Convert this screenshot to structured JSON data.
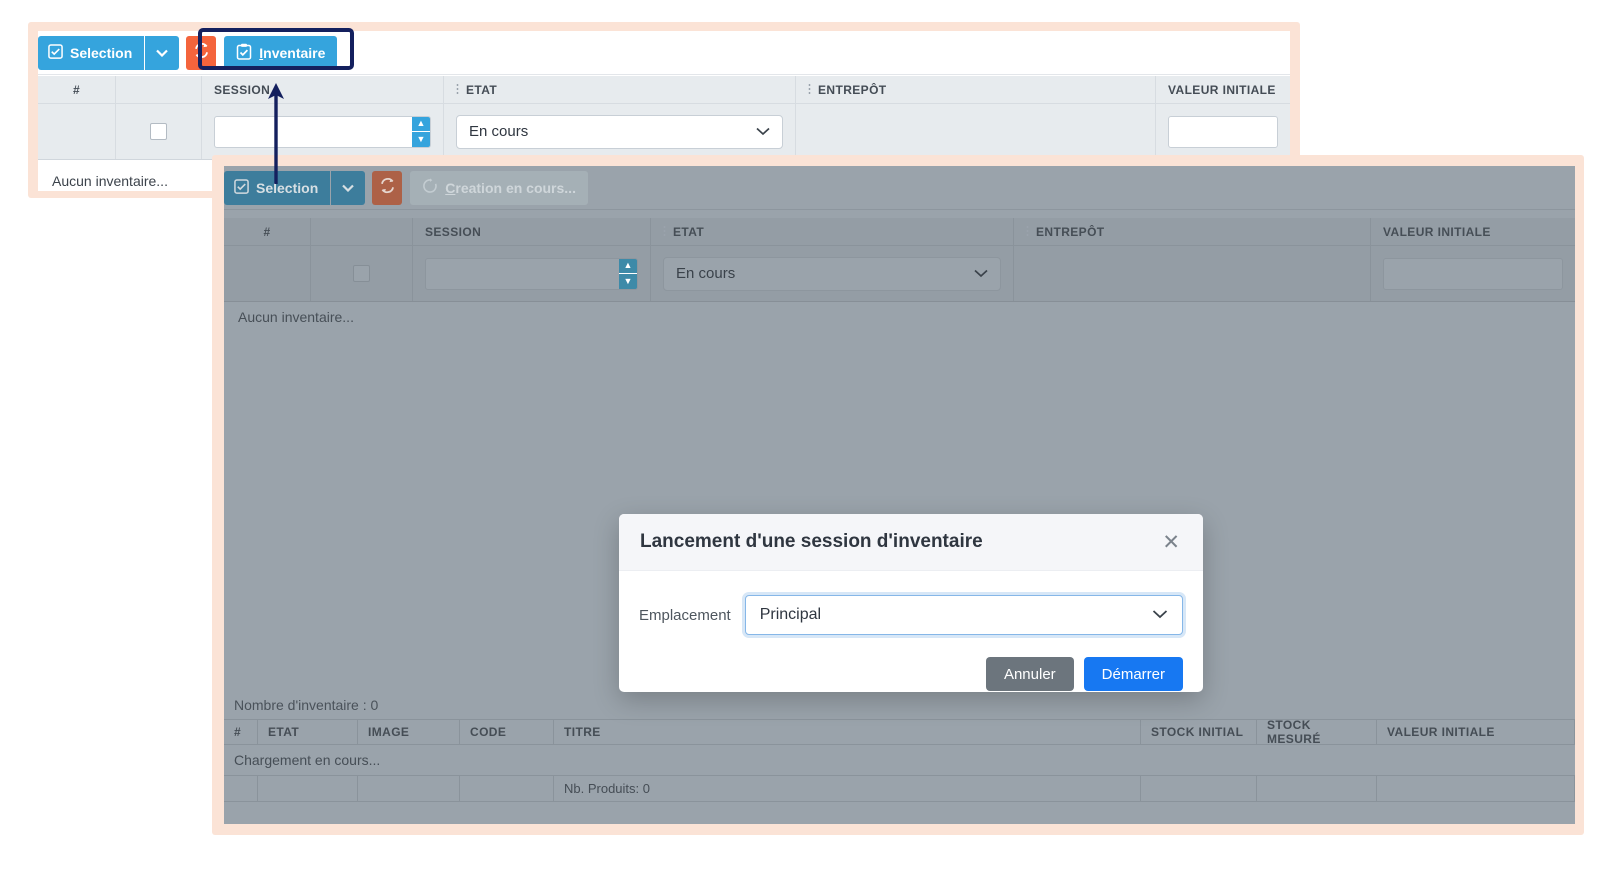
{
  "panel_top": {
    "toolbar": {
      "selection_label": "Selection",
      "selection_icon": "checkbox-checked-icon",
      "caret_icon": "chevron-down-icon",
      "refresh_icon": "refresh-icon",
      "inventaire_label": "Inventaire",
      "inventaire_accesskey": "I",
      "inventaire_icon": "clipboard-check-icon"
    },
    "table": {
      "columns": [
        "#",
        "",
        "SESSION",
        "ETAT",
        "ENTREPÔT",
        "VALEUR INITIALE"
      ],
      "filters": {
        "session_value": "",
        "session_placeholder": "",
        "etat_value": "En cours",
        "entrepot_value": "",
        "valeur_initiale_value": ""
      },
      "empty_message": "Aucun inventaire..."
    }
  },
  "panel_main": {
    "toolbar": {
      "selection_label": "Selection",
      "selection_icon": "checkbox-checked-icon",
      "caret_icon": "chevron-down-icon",
      "refresh_icon": "refresh-icon",
      "creation_label": "Creation en cours...",
      "creation_accesskey": "C",
      "creation_icon": "spinner-icon"
    },
    "table": {
      "columns": [
        "#",
        "",
        "SESSION",
        "ETAT",
        "ENTREPÔT",
        "VALEUR INITIALE"
      ],
      "filters": {
        "session_value": "",
        "etat_value": "En cours",
        "entrepot_value": "",
        "valeur_initiale_value": ""
      },
      "empty_message": "Aucun inventaire...",
      "count_label": "Nombre d'inventaire : 0"
    },
    "products": {
      "columns": [
        "#",
        "ETAT",
        "IMAGE",
        "CODE",
        "TITRE",
        "STOCK INITIAL",
        "STOCK MESURÉ",
        "VALEUR INITIALE"
      ],
      "loading_message": "Chargement en cours...",
      "footer_label": "Nb. Produits: 0"
    }
  },
  "modal": {
    "title": "Lancement d'une session d'inventaire",
    "close_icon": "close-icon",
    "field_label": "Emplacement",
    "field_value": "Principal",
    "field_caret_icon": "chevron-down-icon",
    "cancel_label": "Annuler",
    "confirm_label": "Démarrer"
  },
  "annotation": {
    "arrow_icon": "arrow-up-icon",
    "highlight_color": "#14205e",
    "frame_color": "#fbe3d6"
  }
}
